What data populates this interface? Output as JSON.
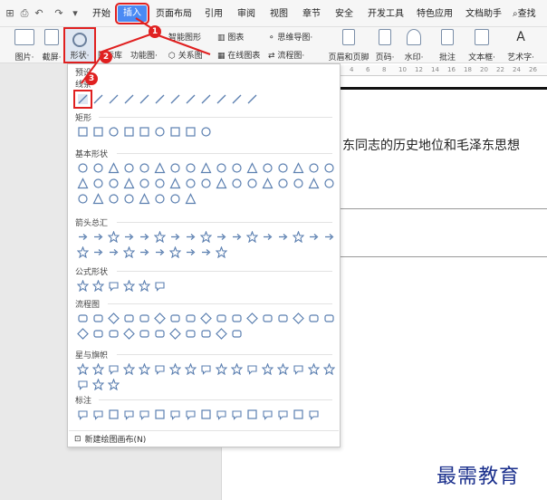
{
  "menubar": {
    "tabs": [
      "开始",
      "插入",
      "页面布局",
      "引用",
      "审阅",
      "视图",
      "章节",
      "安全",
      "开发工具",
      "特色应用",
      "文档助手"
    ],
    "search_label": "查找"
  },
  "ribbon": {
    "picture": "图片·",
    "screenshot": "截屏·",
    "shape": "形状·",
    "iconlib": "图标库",
    "function_chart": "功能图·",
    "smart_art": "智能图形",
    "chart": "图表",
    "relation": "关系图",
    "online_chart": "在线图表",
    "mindmap": "思维导图·",
    "flowchart": "流程图·",
    "header_footer": "页眉和页脚",
    "page_number": "页码·",
    "watermark": "水印·",
    "comment": "批注",
    "textbox": "文本框·",
    "wordart": "艺术字·"
  },
  "panel": {
    "preset_title": "预设",
    "line_title": "线条",
    "sections": [
      {
        "title": "矩形",
        "count": 9
      },
      {
        "title": "基本形状",
        "count": 42
      },
      {
        "title": "箭头总汇",
        "count": 27
      },
      {
        "title": "公式形状",
        "count": 6
      },
      {
        "title": "流程图",
        "count": 28
      },
      {
        "title": "星与旗帜",
        "count": 20
      },
      {
        "title": "标注",
        "count": 16
      }
    ],
    "new_canvas": "新建绘图画布(N)"
  },
  "document": {
    "text": "东同志的历史地位和毛泽东思想"
  },
  "ruler": [
    "4",
    "6",
    "8",
    "10",
    "12",
    "14",
    "16",
    "18",
    "20",
    "22",
    "24",
    "26"
  ],
  "callouts": [
    "1",
    "2",
    "3"
  ],
  "watermark": "最需教育",
  "colors": {
    "accent": "#4a8af4",
    "callout": "#e02020",
    "watermark": "#1a2f8c"
  }
}
